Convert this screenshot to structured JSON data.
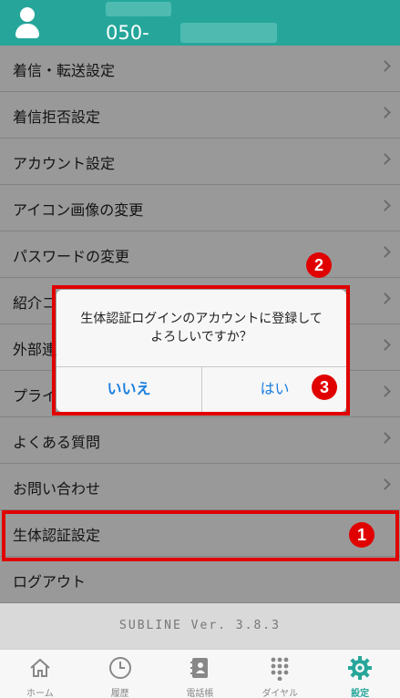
{
  "header": {
    "phone_prefix": "050-"
  },
  "menu": {
    "items": [
      {
        "label": "着信・転送設定"
      },
      {
        "label": "着信拒否設定"
      },
      {
        "label": "アカウント設定"
      },
      {
        "label": "アイコン画像の変更"
      },
      {
        "label": "パスワードの変更"
      },
      {
        "label": "紹介コ"
      },
      {
        "label": "外部連"
      },
      {
        "label": "プライ"
      },
      {
        "label": "よくある質問"
      },
      {
        "label": "お問い合わせ"
      },
      {
        "label": "生体認証設定"
      },
      {
        "label": "ログアウト"
      }
    ]
  },
  "version": "SUBLINE Ver. 3.8.3",
  "dialog": {
    "message_line1": "生体認証ログインのアカウントに登録して",
    "message_line2": "よろしいですか？",
    "no_label": "いいえ",
    "yes_label": "はい"
  },
  "annotations": {
    "step1": "1",
    "step2": "2",
    "step3": "3",
    "color": "#e00000"
  },
  "tabbar": {
    "tabs": [
      {
        "label": "ホーム",
        "icon": "home-icon"
      },
      {
        "label": "履歴",
        "icon": "clock-icon"
      },
      {
        "label": "電話帳",
        "icon": "contacts-icon"
      },
      {
        "label": "ダイヤル",
        "icon": "keypad-icon"
      },
      {
        "label": "設定",
        "icon": "gear-icon",
        "active": true
      }
    ]
  },
  "colors": {
    "accent": "#26a69a",
    "link": "#1a7ee0"
  }
}
